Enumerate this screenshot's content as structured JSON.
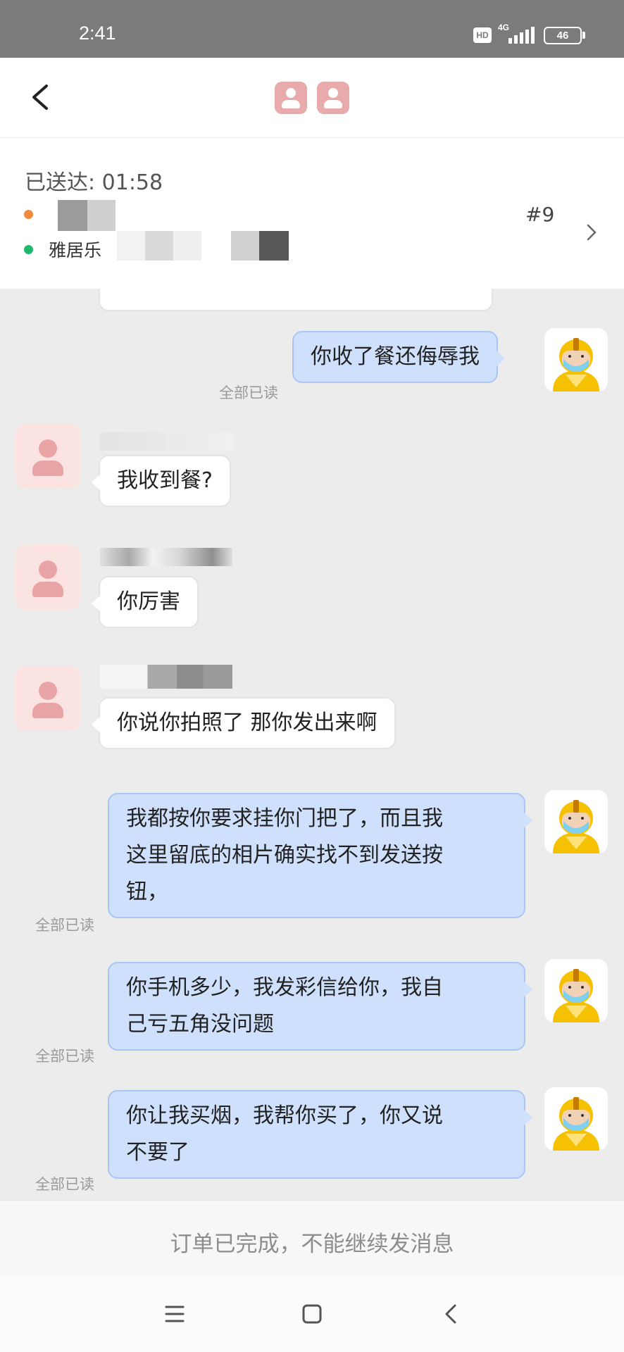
{
  "status_bar": {
    "time": "2:41",
    "hd": "HD",
    "network": "4G",
    "battery": "46"
  },
  "order": {
    "delivered_label": "已送达: 01:58",
    "destination": "雅居乐",
    "number": "#9"
  },
  "messages": [
    {
      "side": "right",
      "text": "你收了餐还侮辱我",
      "status": "全部已读"
    },
    {
      "side": "left",
      "text": "我收到餐?"
    },
    {
      "side": "left",
      "text": "你厉害"
    },
    {
      "side": "left",
      "text": "你说你拍照了  那你发出来啊"
    },
    {
      "side": "right",
      "line1": "我都按你要求挂你门把了，而且我",
      "line2": "这里留底的相片确实找不到发送按",
      "line3": "钮，",
      "status": "全部已读"
    },
    {
      "side": "right",
      "line1": "你手机多少，我发彩信给你，我自",
      "line2": "己亏五角没问题",
      "status": "全部已读"
    },
    {
      "side": "right",
      "line1": "你让我买烟，我帮你买了，你又说",
      "line2": "不要了",
      "status": "全部已读"
    }
  ],
  "footer": {
    "closed_text": "订单已完成，不能继续发消息"
  },
  "colors": {
    "bubble_right": "#cfe0fc",
    "bubble_left": "#ffffff",
    "status_bar": "#7b7b7b",
    "customer_avatar": "#e9a5a5"
  },
  "icons": [
    "back-arrow-icon",
    "chevron-right-icon",
    "menu-icon",
    "home-square-icon",
    "back-nav-icon"
  ]
}
